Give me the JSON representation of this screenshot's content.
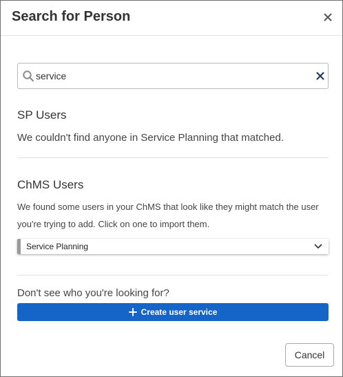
{
  "modal": {
    "title": "Search for Person"
  },
  "search": {
    "value": "service"
  },
  "sp_users": {
    "heading": "SP Users",
    "message": "We couldn't find anyone in Service Planning that matched."
  },
  "chms_users": {
    "heading": "ChMS Users",
    "description": "We found some users in your ChMS that look like they might match the user you're trying to add. Click on one to import them.",
    "select_value": "Service Planning"
  },
  "footer_prompt": {
    "question": "Don't see who you're looking for?",
    "create_label": "Create user service"
  },
  "actions": {
    "cancel_label": "Cancel"
  },
  "colors": {
    "primary": "#1565c8",
    "icon_dark": "#1f3a5f"
  },
  "icons": [
    "close-icon",
    "search-icon",
    "clear-icon",
    "chevron-down-icon",
    "plus-icon"
  ]
}
